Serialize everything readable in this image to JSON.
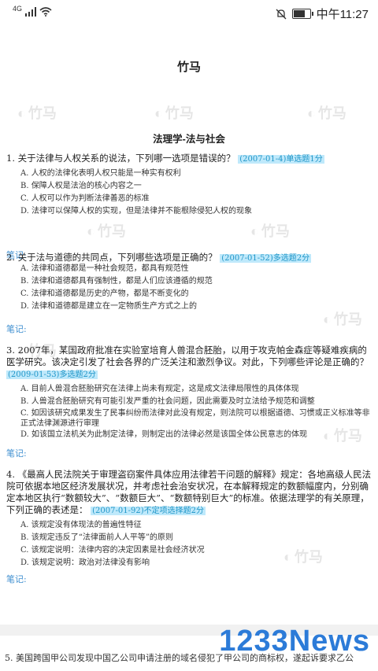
{
  "status_bar": {
    "signal": "4G",
    "time": "中午11:27",
    "battery_level": 0.8
  },
  "document": {
    "title": "竹马",
    "section_title": "法理学-法与社会",
    "watermark_text": "竹马",
    "note_label": "笔记:",
    "questions": [
      {
        "stem": "1. 关于法律与人权关系的说法，下列哪一选项是错误的？",
        "tag": "(2007-01-4)单选题1分",
        "options": [
          "A. 人权的法律化表明人权只能是一种实有权利",
          "B. 保障人权是法治的核心内容之一",
          "C. 人权可以作为判断法律善恶的标准",
          "D. 法律可以保障人权的实现，但是法律并不能根除侵犯人权的现象"
        ]
      },
      {
        "stem": "2. 关于法与道德的共同点，下列哪些选项是正确的？",
        "tag": "(2007-01-52)多选题2分",
        "options": [
          "A. 法律和道德都是一种社会规范，都具有规范性",
          "B. 法律和道德都具有强制性，都是人们应该遵循的规范",
          "C. 法律和道德都是历史的产物，都是不断变化的",
          "D. 法律和道德都是建立在一定物质生产方式之上的"
        ]
      },
      {
        "stem": "3. 2007年，某国政府批准在实验室培育人兽混合胚胎，以用于攻克帕金森症等疑难疾病的医学研究。该决定引发了社会各界的广泛关注和激烈争议。对此，下列哪些评论是正确的？",
        "tag": "(2009-01-53)多选题2分",
        "options": [
          "A. 目前人兽混合胚胎研究在法律上尚未有规定，这是成文法律局限性的具体体现",
          "B. 人兽混合胚胎研究有可能引发严重的社会问题，因此需要及时立法给予规范和调整",
          "C. 如因该研究成果发生了民事纠纷而法律对此没有规定，则法院可以根据道德、习惯或正义标准等非正式法律渊源进行审理",
          "D. 如该国立法机关为此制定法律，则制定出的法律必然是该国全体公民意志的体现"
        ]
      },
      {
        "stem": "4. 《最高人民法院关于审理盗窃案件具体应用法律若干问题的解释》规定：各地高级人民法院可依据本地区经济发展状况，并考虑社会治安状况，在本解释规定的数额幅度内，分别确定本地区执行“数额较大”、“数额巨大”、“数额特别巨大”的标准。依据法理学的有关原理，下列正确的表述是：",
        "tag": "(2007-01-92)不定项选择题2分",
        "options": [
          "A. 该规定没有体现法的普遍性特征",
          "B. 该规定违反了“法律面前人人平等”的原则",
          "C. 该规定说明：法律内容的决定因素是社会经济状况",
          "D. 该规定说明：政治对法律没有影响"
        ]
      }
    ],
    "next_question_preview": "5. 美国跨国甲公司发现中国乙公司申请注册的域名侵犯了甲公司的商标权，遂起诉要求乙公"
  },
  "brand_watermark": "1233News"
}
